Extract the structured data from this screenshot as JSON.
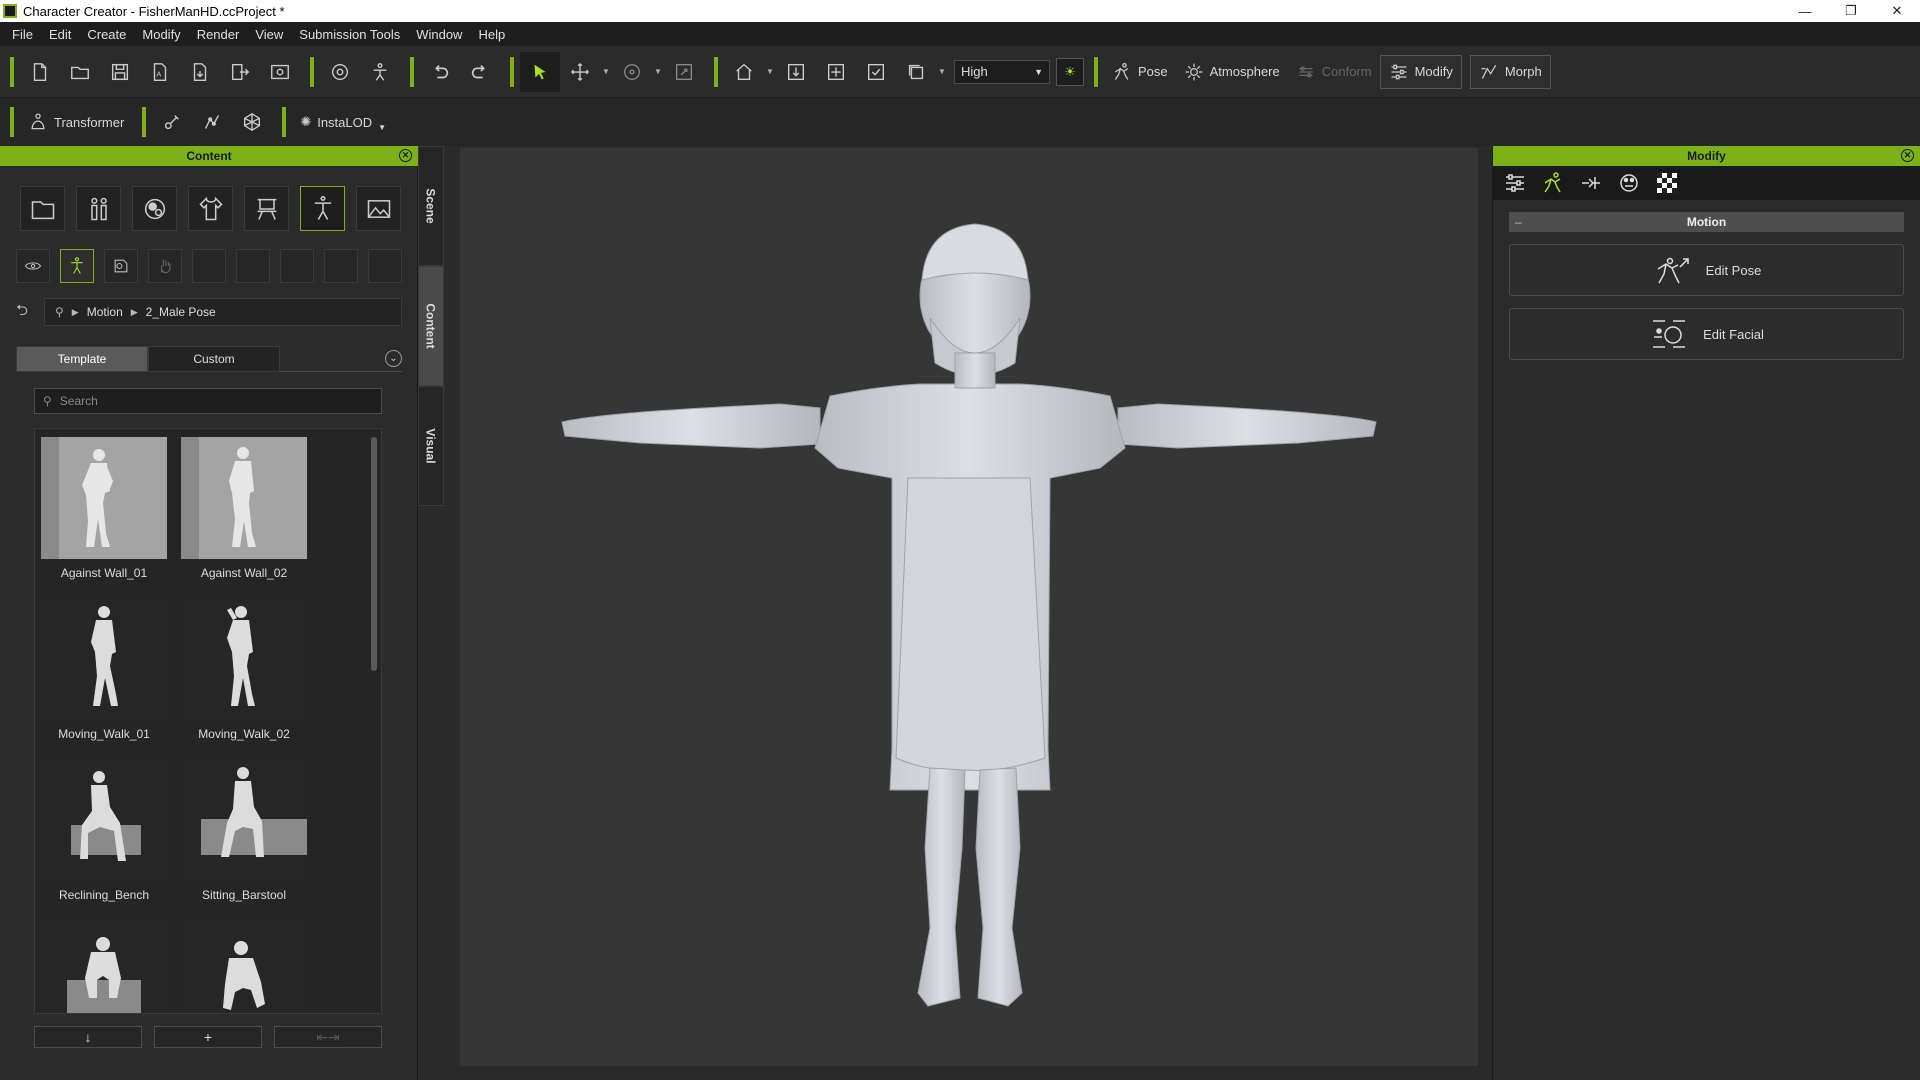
{
  "window": {
    "title": "Character Creator - FisherManHD.ccProject *",
    "minimize_icon": "minimize-icon",
    "maximize_icon": "restore-icon",
    "close_icon": "close-icon"
  },
  "menubar": [
    "File",
    "Edit",
    "Create",
    "Modify",
    "Render",
    "View",
    "Submission Tools",
    "Window",
    "Help"
  ],
  "toolbar": {
    "quality_value": "High",
    "pose_label": "Pose",
    "atmosphere_label": "Atmosphere",
    "conform_label": "Conform",
    "modify_label": "Modify",
    "morph_label": "Morph",
    "transformer_label": "Transformer",
    "instalod_label": "InstaLOD"
  },
  "content_panel": {
    "header": "Content",
    "breadcrumb": [
      "Motion",
      "2_Male Pose"
    ],
    "tabs": [
      "Template",
      "Custom"
    ],
    "active_tab": "Template",
    "search_placeholder": "Search",
    "items": [
      {
        "label": "Against Wall_01"
      },
      {
        "label": "Against Wall_02"
      },
      {
        "label": "Moving_Walk_01"
      },
      {
        "label": "Moving_Walk_02"
      },
      {
        "label": "Reclining_Bench"
      },
      {
        "label": "Sitting_Barstool"
      },
      {
        "label": ""
      },
      {
        "label": ""
      }
    ],
    "bottom_buttons": [
      "↓",
      "+",
      "⇤⇥"
    ]
  },
  "side_tabs": [
    "Scene",
    "Content",
    "Visual"
  ],
  "modify_panel": {
    "header": "Modify",
    "section_title": "Motion",
    "collapse_symbol": "–",
    "buttons": [
      "Edit Pose",
      "Edit Facial"
    ]
  },
  "colors": {
    "accent": "#7cb218",
    "accent_bright": "#a6e22e",
    "background": "#2b2b2b",
    "viewport": "#363636"
  }
}
